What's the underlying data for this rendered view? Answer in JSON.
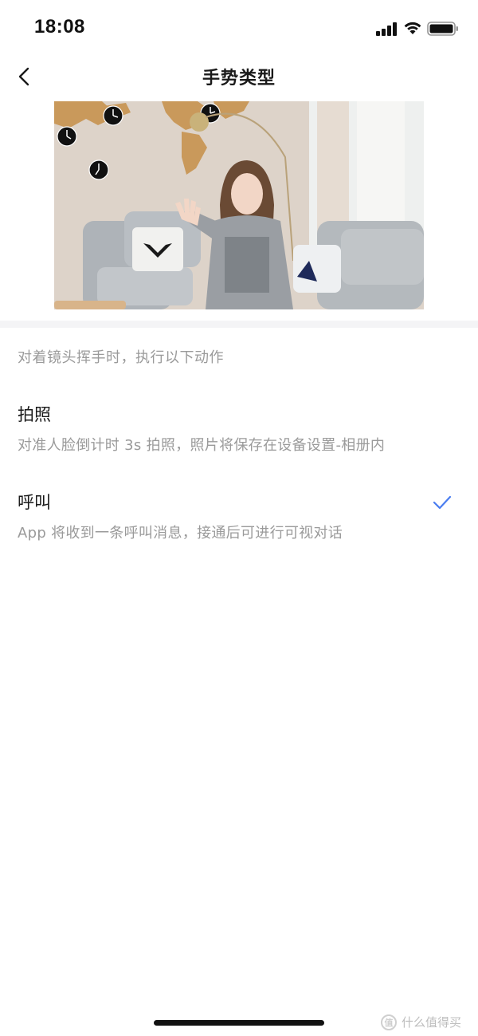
{
  "status_bar": {
    "time": "18:08",
    "icons": [
      "signal-icon",
      "wifi-icon",
      "battery-icon"
    ]
  },
  "nav": {
    "title": "手势类型",
    "back_icon": "chevron-left-icon"
  },
  "preview": {
    "icon": "room-photo"
  },
  "hint": "对着镜头挥手时，执行以下动作",
  "options": [
    {
      "title": "拍照",
      "description": "对准人脸倒计时 3s 拍照，照片将保存在设备设置-相册内",
      "selected": false
    },
    {
      "title": "呼叫",
      "description": "App 将收到一条呼叫消息，接通后可进行可视对话",
      "selected": true
    }
  ],
  "watermark": "什么值得买",
  "colors": {
    "accent": "#4a7df0",
    "secondary_text": "#9a9a9a",
    "primary_text": "#1a1a1a",
    "section_band": "#f4f4f6"
  }
}
